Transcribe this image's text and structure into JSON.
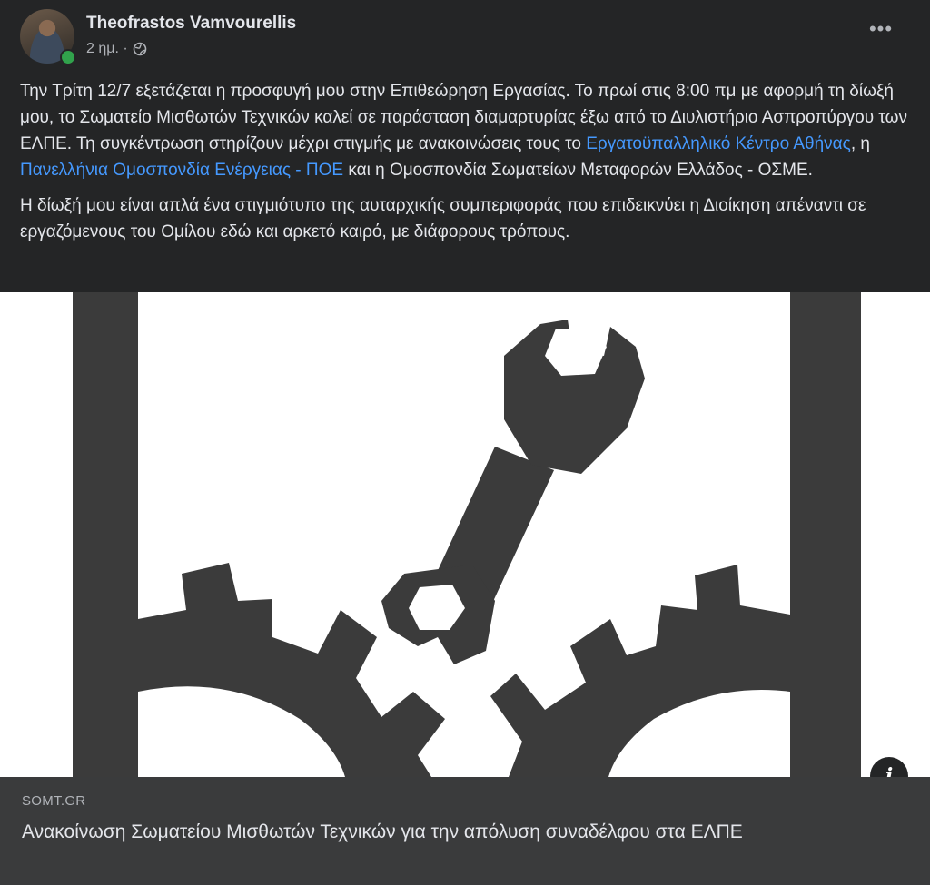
{
  "post": {
    "author": "Theofrastos Vamvourellis",
    "time": "2 ημ. ·",
    "privacy_icon": "globe-icon",
    "more_label": "•••",
    "paragraph1": {
      "text1": "Την Τρίτη 12/7 εξετάζεται η προσφυγή μου στην Επιθεώρηση Εργασίας. Το πρωί στις 8:00 πμ με αφορμή τη δίωξή μου, το Σωματείο Μισθωτών Τεχνικών καλεί σε παράσταση διαμαρτυρίας έξω από το Διυλιστήριο Ασπροπύργου των ΕΛΠΕ. Τη συγκέντρωση στηρίζουν μέχρι στιγμής με ανακοινώσεις τους το ",
      "link1": "Εργατοϋπαλληλικό Κέντρο Αθήνας",
      "text2": ", η ",
      "link2": "Πανελλήνια Ομοσπονδία Ενέργειας - ΠΟΕ",
      "text3": " και η Ομοσπονδία Σωματείων Μεταφορών Ελλάδος - ΟΣΜΕ."
    },
    "paragraph2": "Η δίωξή μου είναι απλά ένα στιγμιότυπο της αυταρχικής συμπεριφοράς που επιδεικνύει η Διοίκηση απέναντι σε εργαζόμενους του Ομίλου εδώ και αρκετό καιρό, με διάφορους τρόπους."
  },
  "link_preview": {
    "domain": "SOMT.GR",
    "title": "Ανακοίνωση Σωματείου Μισθωτών Τεχνικών για την απόλυση συναδέλφου στα ΕΛΠΕ",
    "info_label": "i"
  },
  "colors": {
    "background": "#242526",
    "text": "#e4e6eb",
    "secondary": "#b0b3b8",
    "link": "#4599ff",
    "online": "#31a24c",
    "preview_bg": "#3a3b3c",
    "logo_dark": "#3b3b3b"
  }
}
